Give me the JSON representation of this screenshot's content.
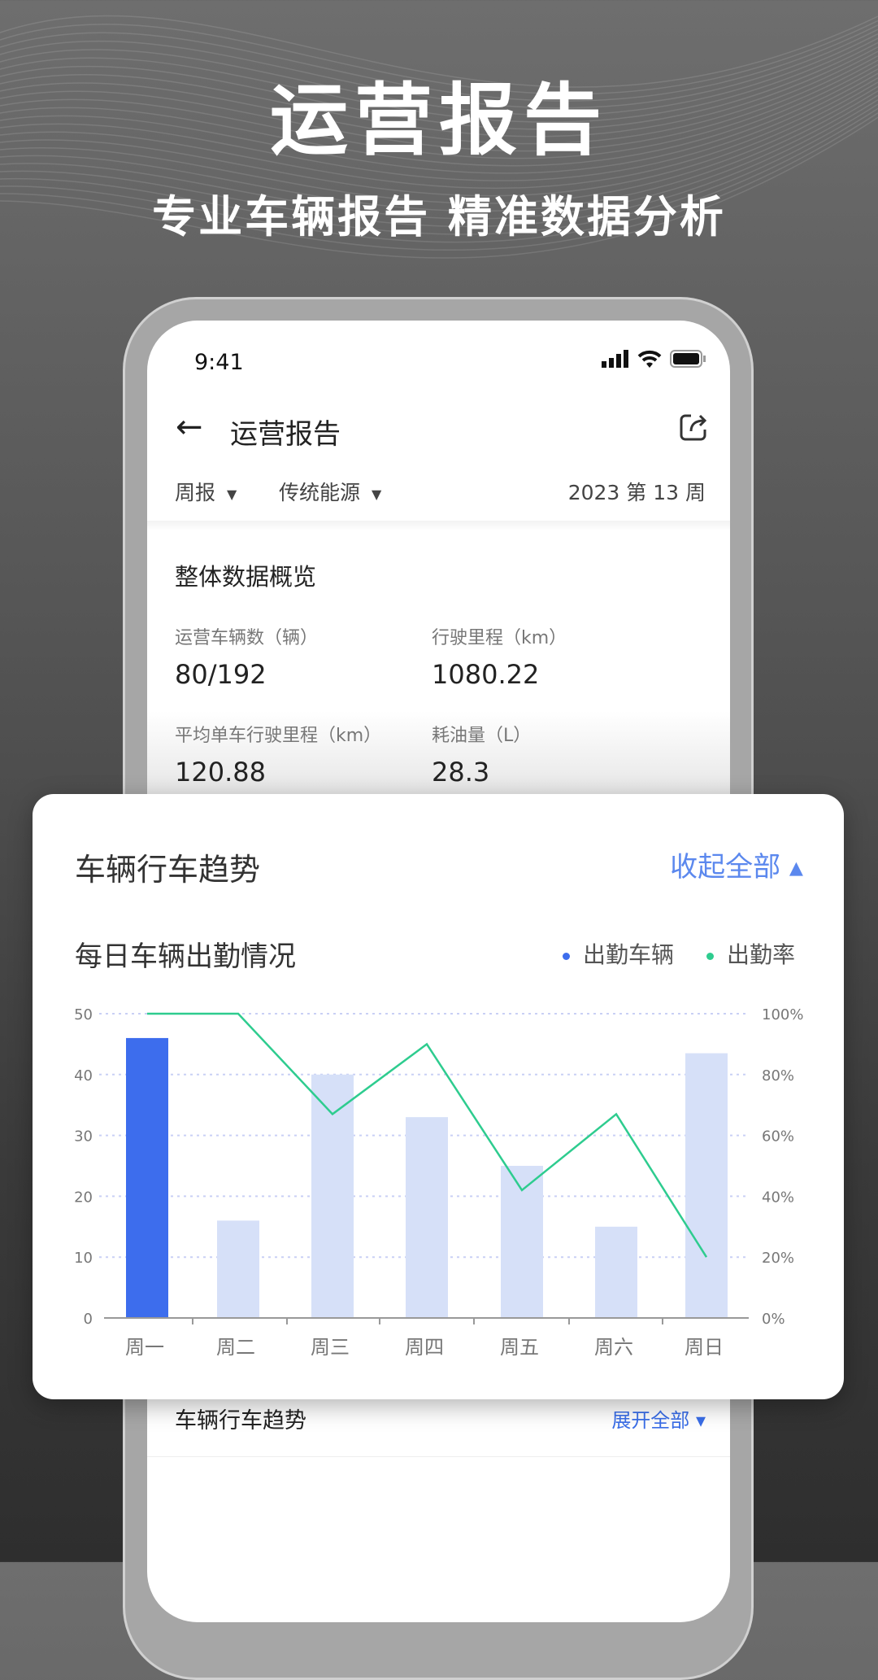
{
  "hero": {
    "title": "运营报告",
    "subtitle": "专业车辆报告 精准数据分析"
  },
  "status_bar": {
    "time": "9:41",
    "icons": [
      "signal-icon",
      "wifi-icon",
      "battery-icon"
    ]
  },
  "nav": {
    "title": "运营报告",
    "back_icon": "arrow-left-icon",
    "share_icon": "share-icon"
  },
  "filters": {
    "period": "周报",
    "energy": "传统能源",
    "week": "2023 第 13 周"
  },
  "overview": {
    "title": "整体数据概览",
    "stats": [
      {
        "label": "运营车辆数（辆）",
        "value": "80/192"
      },
      {
        "label": "行驶里程（km）",
        "value": "1080.22"
      },
      {
        "label": "平均单车行驶里程（km）",
        "value": "120.88"
      },
      {
        "label": "耗油量（L）",
        "value": "28.3"
      }
    ]
  },
  "section2": {
    "title": "车辆行车趋势",
    "button": "展开全部 ▾"
  },
  "card": {
    "title": "车辆行车趋势",
    "collapse": "收起全部 ▴",
    "subtitle": "每日车辆出勤情况"
  },
  "colors": {
    "accent": "#3d6ded",
    "bar_light": "#d6e0f8",
    "line": "#2ecc8f"
  },
  "chart_data": {
    "type": "bar+line",
    "categories": [
      "周一",
      "周二",
      "周三",
      "周四",
      "周五",
      "周六",
      "周日"
    ],
    "series": [
      {
        "name": "出勤车辆",
        "type": "bar",
        "axis": "left",
        "values": [
          46,
          16,
          40,
          33,
          25,
          15,
          43.5
        ]
      },
      {
        "name": "出勤率",
        "type": "line",
        "axis": "right",
        "values": [
          100,
          100,
          67,
          90,
          42,
          67,
          20
        ]
      }
    ],
    "y_left": {
      "range": [
        0,
        50
      ],
      "ticks": [
        "0",
        "10",
        "20",
        "30",
        "40",
        "50"
      ]
    },
    "y_right": {
      "range": [
        0,
        100
      ],
      "ticks": [
        "0%",
        "20%",
        "40%",
        "60%",
        "80%",
        "100%"
      ]
    },
    "highlighted_category": "周一",
    "grid": true,
    "legend": "top-right"
  }
}
